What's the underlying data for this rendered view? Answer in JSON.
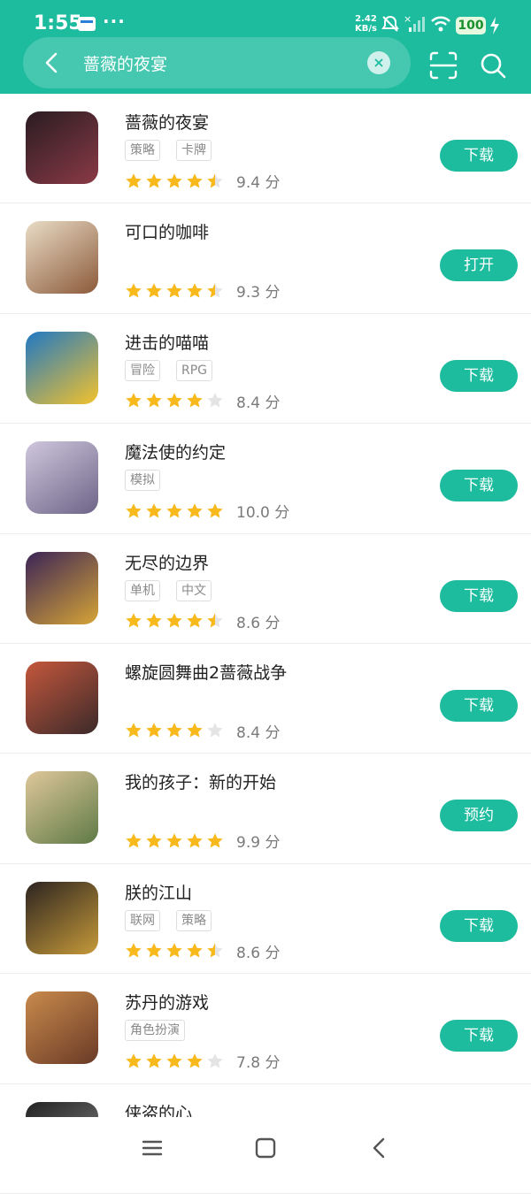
{
  "status": {
    "time": "1:55",
    "dots": "···",
    "net_speed_value": "2.42",
    "net_speed_unit": "KB/s",
    "battery": "100"
  },
  "search": {
    "query": "蔷薇的夜宴",
    "placeholder": "",
    "back_icon": "chevron-left-icon",
    "clear_icon": "close-icon",
    "scan_icon": "scan-icon",
    "search_icon": "search-icon"
  },
  "colors": {
    "accent": "#1dbc9e",
    "star_on": "#f8b91c",
    "star_off": "#e4e4e4"
  },
  "apps": [
    {
      "name": "蔷薇的夜宴",
      "tags": [
        "策略",
        "卡牌"
      ],
      "stars": 4.5,
      "score": "9.4 分",
      "action": "下载"
    },
    {
      "name": "可口的咖啡",
      "tags": [],
      "stars": 4.5,
      "score": "9.3 分",
      "action": "打开"
    },
    {
      "name": "进击的喵喵",
      "tags": [
        "冒险",
        "RPG"
      ],
      "stars": 4,
      "score": "8.4 分",
      "action": "下载"
    },
    {
      "name": "魔法使的约定",
      "tags": [
        "模拟"
      ],
      "stars": 5,
      "score": "10.0 分",
      "action": "下载"
    },
    {
      "name": "无尽的边界",
      "tags": [
        "单机",
        "中文"
      ],
      "stars": 4.5,
      "score": "8.6 分",
      "action": "下载"
    },
    {
      "name": "螺旋圆舞曲2蔷薇战争",
      "tags": [],
      "stars": 4,
      "score": "8.4 分",
      "action": "下载"
    },
    {
      "name": "我的孩子：新的开始",
      "tags": [],
      "stars": 5,
      "score": "9.9 分",
      "action": "预约"
    },
    {
      "name": "朕的江山",
      "tags": [
        "联网",
        "策略"
      ],
      "stars": 4.5,
      "score": "8.6 分",
      "action": "下载"
    },
    {
      "name": "苏丹的游戏",
      "tags": [
        "角色扮演"
      ],
      "stars": 4,
      "score": "7.8 分",
      "action": "下载"
    },
    {
      "name": "侠盗的心",
      "tags": [],
      "stars": 0,
      "score": "",
      "action": ""
    }
  ],
  "nav": {
    "menu_icon": "menu-icon",
    "home_icon": "home-square-icon",
    "back_icon": "back-triangle-icon"
  }
}
